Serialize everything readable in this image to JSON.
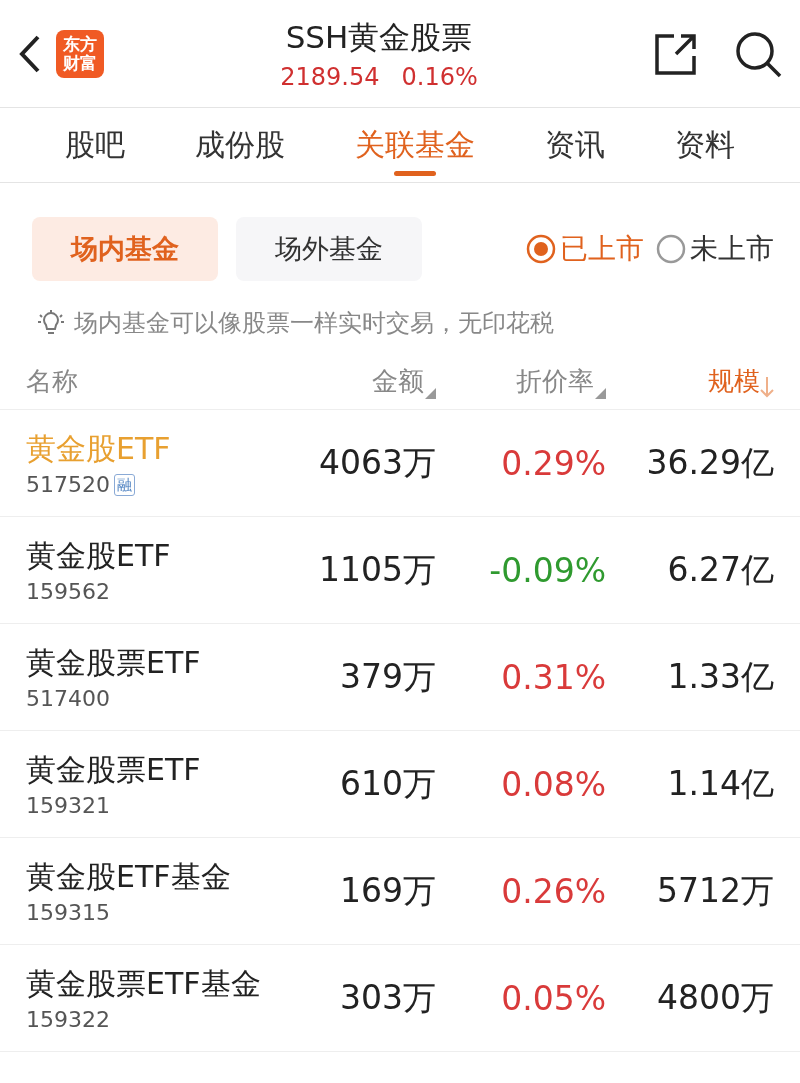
{
  "header": {
    "logo_text": [
      "东方",
      "财富"
    ],
    "title": "SSH黄金股票",
    "price": "2189.54",
    "change": "0.16%"
  },
  "tabs": [
    {
      "label": "股吧",
      "selected": false
    },
    {
      "label": "成份股",
      "selected": false
    },
    {
      "label": "关联基金",
      "selected": true
    },
    {
      "label": "资讯",
      "selected": false
    },
    {
      "label": "资料",
      "selected": false
    }
  ],
  "segments": [
    {
      "label": "场内基金",
      "selected": true
    },
    {
      "label": "场外基金",
      "selected": false
    }
  ],
  "radios": [
    {
      "label": "已上市",
      "selected": true
    },
    {
      "label": "未上市",
      "selected": false
    }
  ],
  "tip": "场内基金可以像股票一样实时交易，无印花税",
  "columns": [
    {
      "label": "名称",
      "sorted": false,
      "sortable": false
    },
    {
      "label": "金额",
      "sorted": false,
      "sortable": true
    },
    {
      "label": "折价率",
      "sorted": false,
      "sortable": true
    },
    {
      "label": "规模",
      "sorted": true,
      "sortable": true
    }
  ],
  "rows": [
    {
      "name": "黄金股ETF",
      "code": "517520",
      "badge": "融",
      "selected": true,
      "amount": "4063万",
      "rate": "0.29%",
      "color": "#d93a3a",
      "scale": "36.29亿"
    },
    {
      "name": "黄金股ETF",
      "code": "159562",
      "selected": false,
      "amount": "1105万",
      "rate": "-0.09%",
      "color": "#2f9a2f",
      "scale": "6.27亿"
    },
    {
      "name": "黄金股票ETF",
      "code": "517400",
      "selected": false,
      "amount": "379万",
      "rate": "0.31%",
      "color": "#d93a3a",
      "scale": "1.33亿"
    },
    {
      "name": "黄金股票ETF",
      "code": "159321",
      "selected": false,
      "amount": "610万",
      "rate": "0.08%",
      "color": "#d93a3a",
      "scale": "1.14亿"
    },
    {
      "name": "黄金股ETF基金",
      "code": "159315",
      "selected": false,
      "amount": "169万",
      "rate": "0.26%",
      "color": "#d93a3a",
      "scale": "5712万"
    },
    {
      "name": "黄金股票ETF基金",
      "code": "159322",
      "selected": false,
      "amount": "303万",
      "rate": "0.05%",
      "color": "#d93a3a",
      "scale": "4800万"
    }
  ]
}
